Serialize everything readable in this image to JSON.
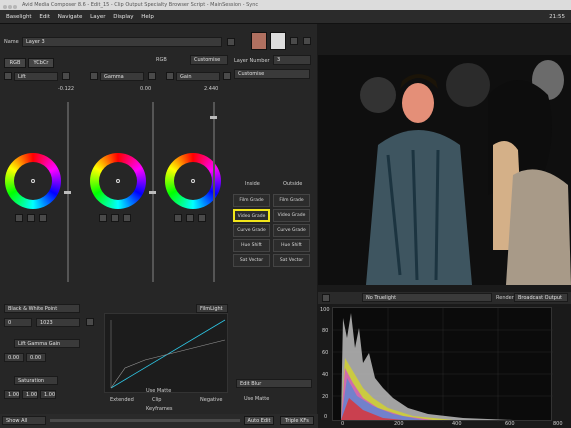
{
  "titlebar": {
    "text": "Avid Media Composer 8.6 - Edit_15 - Clip Output Specialty Browser Script - MainSession - Sync"
  },
  "menubar": {
    "items": [
      "Baselight",
      "Edit",
      "Navigate",
      "Layer",
      "Display",
      "Help"
    ],
    "clock": "21:55"
  },
  "panel": {
    "name_label": "Name",
    "name_value": "Layer 3",
    "tabs": [
      "RGB",
      "YCbCr"
    ],
    "mode": "RGB",
    "preset": "Customise",
    "wheels": [
      {
        "label": "Lift",
        "value": "-0.122"
      },
      {
        "label": "Gamma",
        "value": "0.00"
      },
      {
        "label": "Gain",
        "value": "2.440"
      }
    ],
    "layer_number_label": "Layer Number",
    "layer_number_value": "3",
    "customise": "Customise"
  },
  "operator_grid": {
    "header_left": "Inside",
    "header_right": "Outside",
    "items": [
      [
        "Film Grade",
        "Film Grade"
      ],
      [
        "Video Grade",
        "Video Grade"
      ],
      [
        "Curve Grade",
        "Curve Grade"
      ],
      [
        "Hue Shift",
        "Hue Shift"
      ],
      [
        "Sat Vector",
        "Sat Vector"
      ]
    ],
    "selected": "Video Grade"
  },
  "lower_panel": {
    "bw_label": "Black & White Point",
    "bw_values": [
      "0",
      "1023"
    ],
    "lift_gamma_gain": "Lift Gamma Gain",
    "lgg_values": [
      "0.00",
      "0.00"
    ],
    "saturation_label": "Saturation",
    "sat_values": [
      "1.00",
      "1.00",
      "1.00"
    ],
    "filmlight": "FilmLight",
    "options": [
      "Extended",
      "Clip",
      "Negative"
    ],
    "edit_blur": "Edit Blur",
    "use_matte": "Use Matte",
    "use_matte2": "Use Matte"
  },
  "timeline": {
    "show_all": "Show All",
    "keyframes": "Keyframes",
    "auto_edit": "Auto Edit",
    "triple_kf": "Triple KFs"
  },
  "scope": {
    "truelight": "No Truelight",
    "render_label": "Render",
    "render_value": "Broadcast Output",
    "y_ticks": [
      "100",
      "80",
      "60",
      "40",
      "20",
      "0"
    ],
    "x_ticks": [
      "0",
      "200",
      "400",
      "600",
      "800"
    ]
  },
  "colors": {
    "highlight": "#f2e61a",
    "background": "#262626"
  }
}
